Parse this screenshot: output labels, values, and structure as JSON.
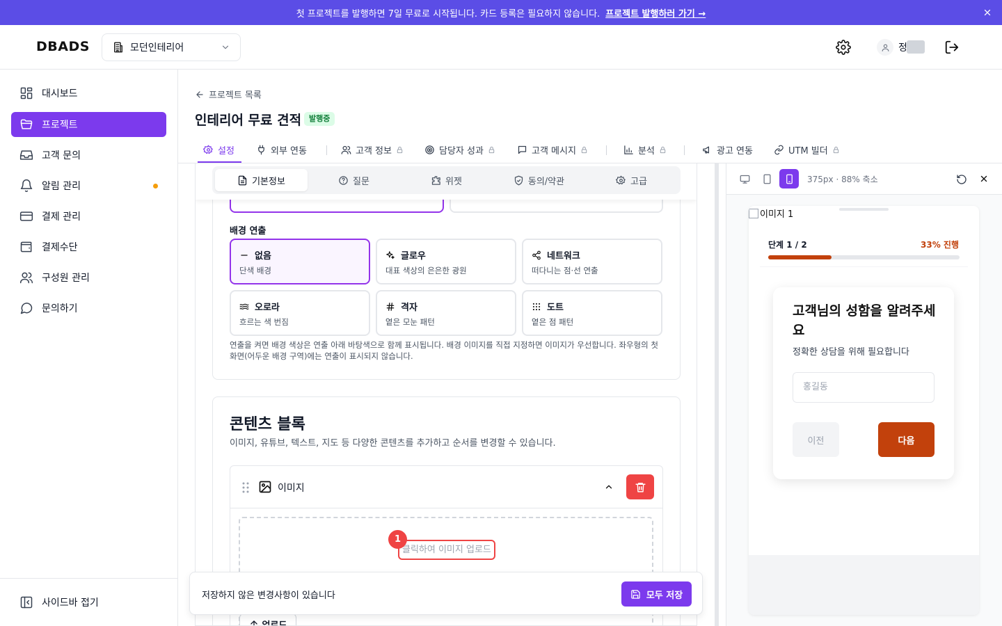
{
  "banner": {
    "text": "첫 프로젝트를 발행하면 7일 무료로 시작됩니다. 카드 등록은 필요하지 않습니다.",
    "link": "프로젝트 발행하러 가기 →"
  },
  "header": {
    "logo": "DBADS",
    "org_name": "모던인테리어",
    "user_name": "정"
  },
  "sidebar": {
    "items": [
      {
        "label": "대시보드",
        "icon": "dashboard-icon"
      },
      {
        "label": "프로젝트",
        "icon": "folder-icon",
        "active": true
      },
      {
        "label": "고객 문의",
        "icon": "inbox-icon"
      },
      {
        "label": "알림 관리",
        "icon": "bell-icon",
        "dot": true
      },
      {
        "label": "결제 관리",
        "icon": "credit-card-icon"
      },
      {
        "label": "결제수단",
        "icon": "wallet-icon"
      },
      {
        "label": "구성원 관리",
        "icon": "users-icon"
      },
      {
        "label": "문의하기",
        "icon": "chat-icon"
      }
    ],
    "collapse_label": "사이드바 접기"
  },
  "project": {
    "back_label": "프로젝트 목록",
    "title": "인테리어 무료 견적",
    "status": "발행중"
  },
  "tabs": [
    {
      "label": "설정",
      "icon": "gear-icon",
      "active": true
    },
    {
      "label": "외부 연동",
      "icon": "plug-icon"
    },
    {
      "label": "고객 정보",
      "icon": "users-icon",
      "locked": true
    },
    {
      "label": "담당자 성과",
      "icon": "target-icon",
      "locked": true
    },
    {
      "label": "고객 메시지",
      "icon": "message-icon",
      "locked": true
    },
    {
      "label": "분석",
      "icon": "bar-chart-icon",
      "locked": true
    },
    {
      "label": "광고 연동",
      "icon": "megaphone-icon"
    },
    {
      "label": "UTM 빌더",
      "icon": "link-icon",
      "locked": true
    }
  ],
  "sub_tabs": [
    {
      "label": "기본정보",
      "icon": "document-icon",
      "active": true
    },
    {
      "label": "질문",
      "icon": "question-icon"
    },
    {
      "label": "위젯",
      "icon": "puzzle-icon"
    },
    {
      "label": "동의/약관",
      "icon": "shield-check-icon"
    },
    {
      "label": "고급",
      "icon": "gear-icon"
    }
  ],
  "background": {
    "label": "배경 연출",
    "options": [
      {
        "title": "없음",
        "desc": "단색 배경",
        "icon": "minus-icon",
        "selected": true
      },
      {
        "title": "글로우",
        "desc": "대표 색상의 은은한 광원",
        "icon": "sparkle-icon"
      },
      {
        "title": "네트워크",
        "desc": "떠다니는 점·선 연출",
        "icon": "network-icon"
      },
      {
        "title": "오로라",
        "desc": "흐르는 색 번짐",
        "icon": "waves-icon"
      },
      {
        "title": "격자",
        "desc": "옅은 모눈 패턴",
        "icon": "hash-icon"
      },
      {
        "title": "도트",
        "desc": "옅은 점 패턴",
        "icon": "dots-grid-icon"
      }
    ],
    "help": "연출을 켜면 배경 색상은 연출 아래 바탕색으로 함께 표시됩니다. 배경 이미지를 직접 지정하면 이미지가 우선합니다. 좌우형의 첫 화면(어두운 배경 구역)에는 연출이 표시되지 않습니다."
  },
  "content_blocks": {
    "title": "콘텐츠 블록",
    "desc": "이미지, 유튜브, 텍스트, 지도 등 다양한 콘텐츠를 추가하고 순서를 변경할 수 있습니다.",
    "block_name": "이미지",
    "upload_prompt": "클릭하여 이미지 업로드",
    "marker": "1",
    "upload_button": "업로드"
  },
  "savebar": {
    "message": "저장하지 않은 변경사항이 있습니다",
    "save_label": "모두 저장"
  },
  "preview": {
    "info": "375px · 88% 축소",
    "image_alt": "이미지 1",
    "step": "단계 1 / 2",
    "progress_label": "33% 진행",
    "progress": 0.33,
    "question": "고객님의 성함을 알려주세요",
    "subtitle": "정확한 상담을 위해 필요합니다",
    "input_placeholder": "홍길동",
    "prev_label": "이전",
    "next_label": "다음"
  },
  "colors": {
    "accent": "#7c3aed",
    "banner": "#5b4de6",
    "preview_primary": "#c2410c",
    "danger": "#ef4444"
  }
}
